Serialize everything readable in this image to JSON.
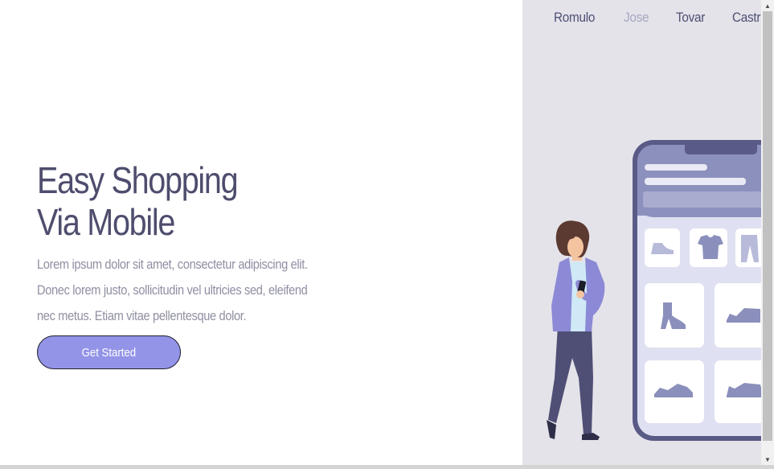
{
  "nav": {
    "items": [
      {
        "label": "Romulo",
        "active": false
      },
      {
        "label": "Jose",
        "active": true
      },
      {
        "label": "Tovar",
        "active": false
      },
      {
        "label": "Castro",
        "active": false
      }
    ]
  },
  "hero": {
    "title_line1": "Easy Shopping",
    "title_line2": "Via Mobile",
    "text": "Lorem ipsum dolor sit amet, consectetur adipiscing elit. Donec lorem justo, sollicitudin vel ultricies sed, eleifend nec metus. Etiam vitae pellentesque dolor.",
    "cta_label": "Get Started"
  },
  "colors": {
    "accent": "#9394e8",
    "heading": "#4e4d6e",
    "panel": "#e4e3ea",
    "nav_active": "#a7a7c0"
  },
  "scrollbar": {
    "up_icon": "up-arrow-icon",
    "down_icon": "down-arrow-icon"
  }
}
